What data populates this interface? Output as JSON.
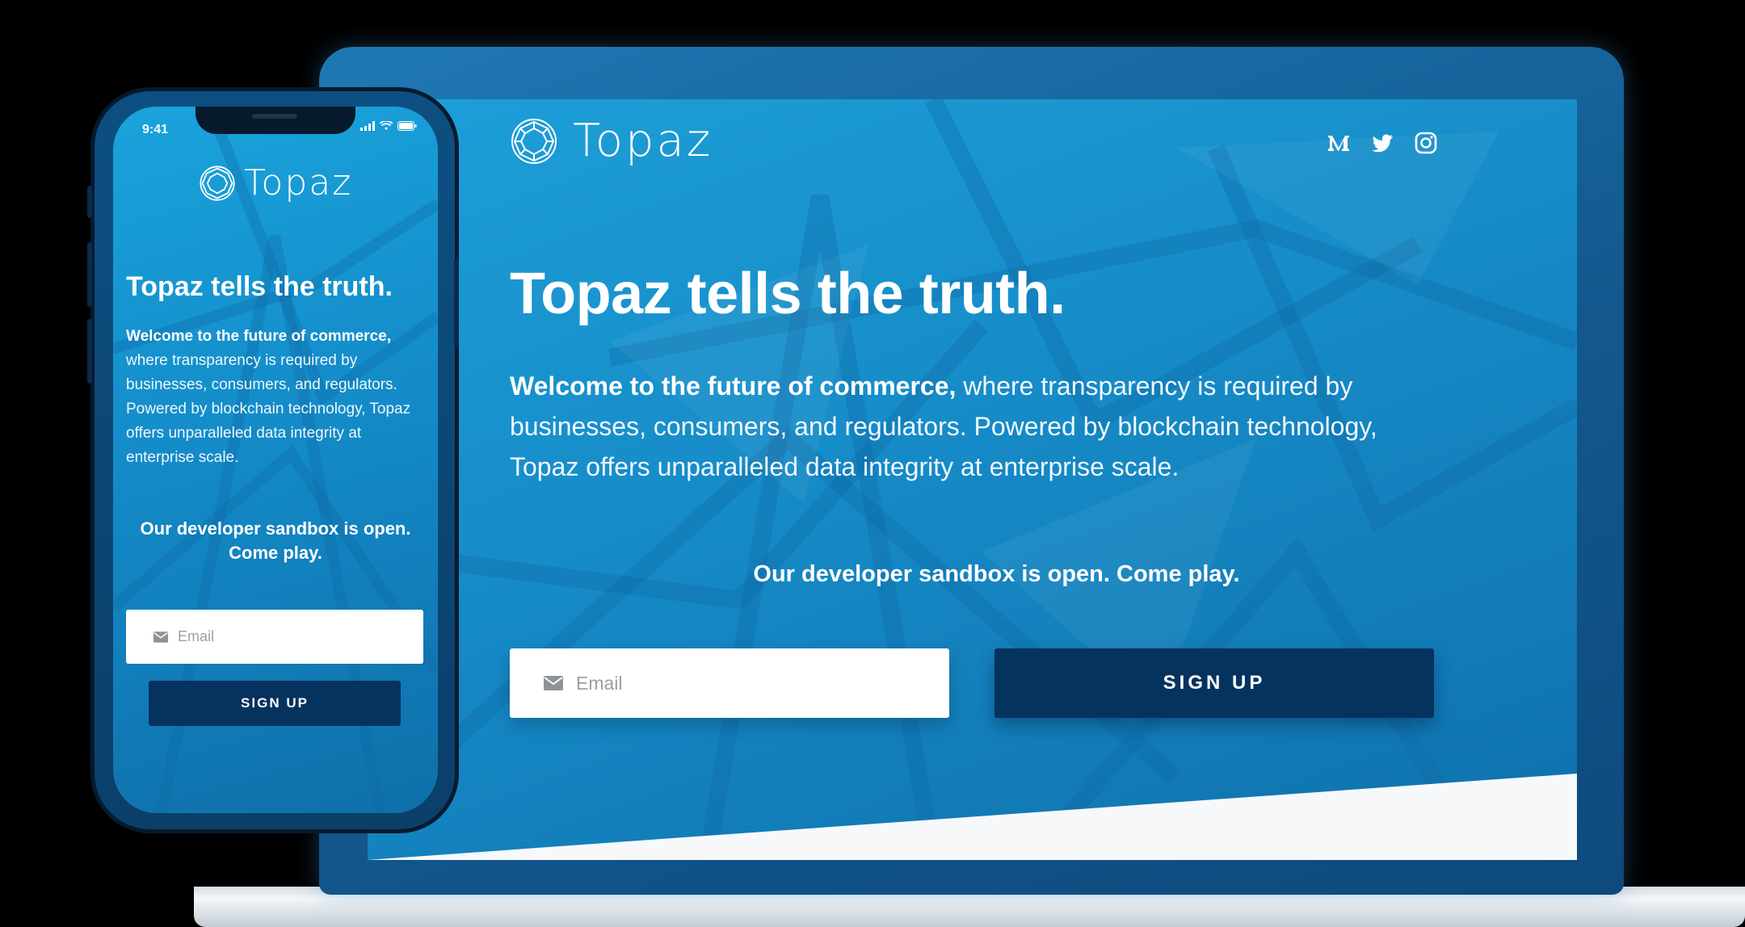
{
  "brand": {
    "name": "Topaz"
  },
  "laptop": {
    "socials": [
      {
        "icon": "medium-icon",
        "label": "Medium"
      },
      {
        "icon": "twitter-icon",
        "label": "Twitter"
      },
      {
        "icon": "instagram-icon",
        "label": "Instagram"
      }
    ],
    "heading": "Topaz tells the truth.",
    "intro_bold": "Welcome to the future of commerce,",
    "intro_rest": " where transparency is required by businesses, consumers, and regulators. Powered by blockchain technology, Topaz offers unparalleled data integrity at enterprise scale.",
    "sandbox": "Our developer sandbox is open. Come play.",
    "email_placeholder": "Email",
    "signup_label": "SIGN UP"
  },
  "phone": {
    "status_time": "9:41",
    "heading": "Topaz tells the truth.",
    "intro_bold": "Welcome to the future of commerce,",
    "intro_rest": " where transparency is required by businesses, consumers, and regulators. Powered by blockchain technology, Topaz offers unparalleled data integrity at enterprise scale.",
    "sandbox_line1": "Our developer sandbox is open.",
    "sandbox_line2": "Come play.",
    "email_placeholder": "Email",
    "signup_label": "SIGN UP"
  },
  "colors": {
    "primary_blue": "#168bc7",
    "button_navy": "#06325e",
    "frame_blue": "#12588f"
  }
}
